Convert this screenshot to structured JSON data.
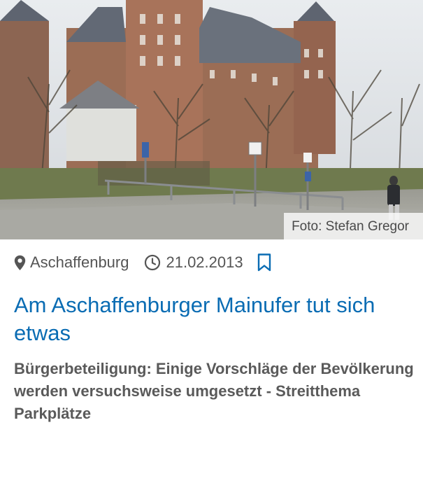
{
  "article": {
    "image": {
      "alt": "",
      "credit": "Foto: Stefan Gregor"
    },
    "meta": {
      "location": "Aschaffenburg",
      "date": "21.02.2013",
      "location_icon": "map-marker-icon",
      "date_icon": "clock-icon",
      "bookmark_icon": "bookmark-icon"
    },
    "headline": "Am Aschaffenburger Mainufer tut sich etwas",
    "teaser": "Bürgerbeteiligung: Einige Vorschläge der Bevölkerung werden versuchsweise umgesetzt - Streitthema Parkplätze"
  },
  "colors": {
    "headline": "#0a6cb3",
    "meta_text": "#555555",
    "bookmark": "#0a6cb3",
    "teaser": "#5a5a5a"
  }
}
